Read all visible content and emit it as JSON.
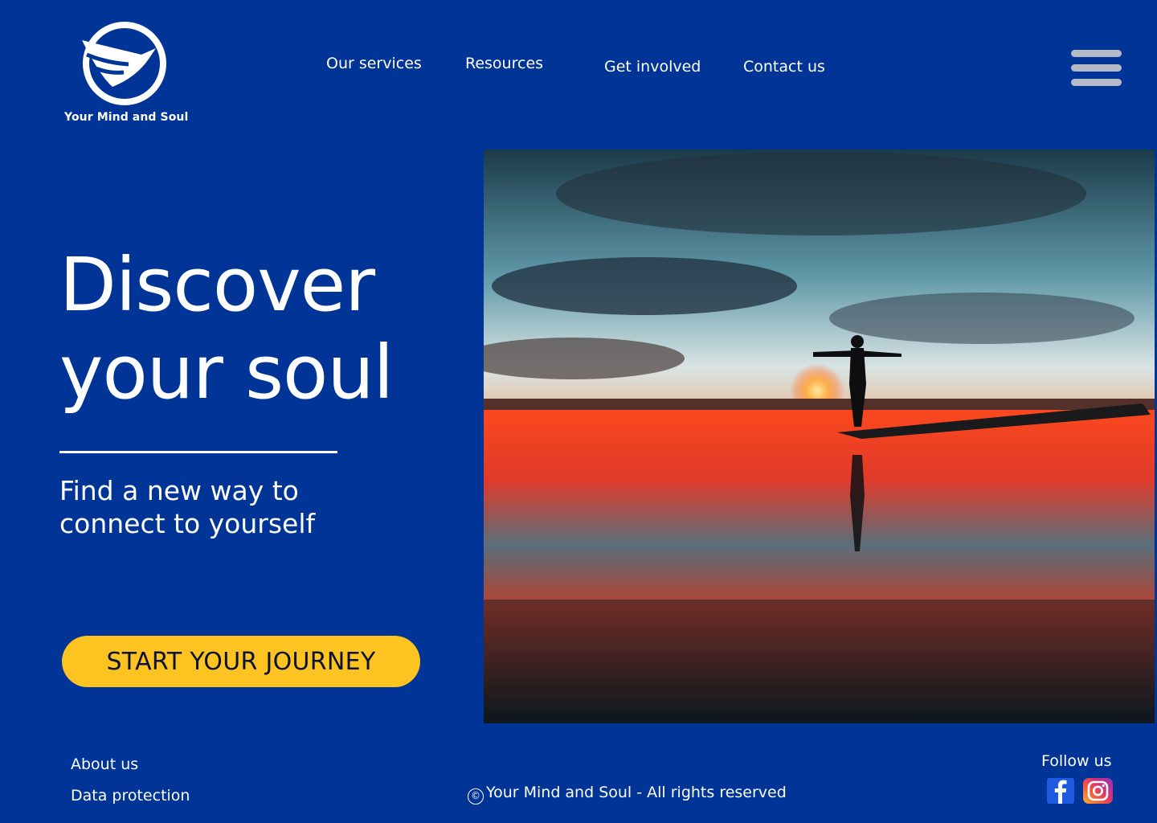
{
  "brand": {
    "name": "Your Mind and Soul",
    "logo_icon": "bird-circle-logo-icon"
  },
  "nav": {
    "items": [
      {
        "label": "Our services"
      },
      {
        "label": "Resources"
      },
      {
        "label": "Get involved"
      },
      {
        "label": "Contact us"
      }
    ],
    "menu_icon": "hamburger-menu-icon"
  },
  "hero": {
    "title_line1": "Discover",
    "title_line2": "your soul",
    "subtitle_line1": "Find a new way to",
    "subtitle_line2": "connect to yourself",
    "cta_label": "START YOUR JOURNEY",
    "cta_color": "#fdc321",
    "image": "sunset-beach-silhouette-photo"
  },
  "footer": {
    "links": [
      {
        "label": "About us"
      },
      {
        "label": "Data protection"
      }
    ],
    "copyright_symbol": "©",
    "copyright": "Your Mind and Soul - All rights reserved",
    "follow_label": "Follow us",
    "social": [
      {
        "icon": "facebook-icon"
      },
      {
        "icon": "instagram-icon"
      }
    ]
  },
  "colors": {
    "background": "#003497",
    "accent": "#fdc321",
    "text": "#ffffff"
  }
}
